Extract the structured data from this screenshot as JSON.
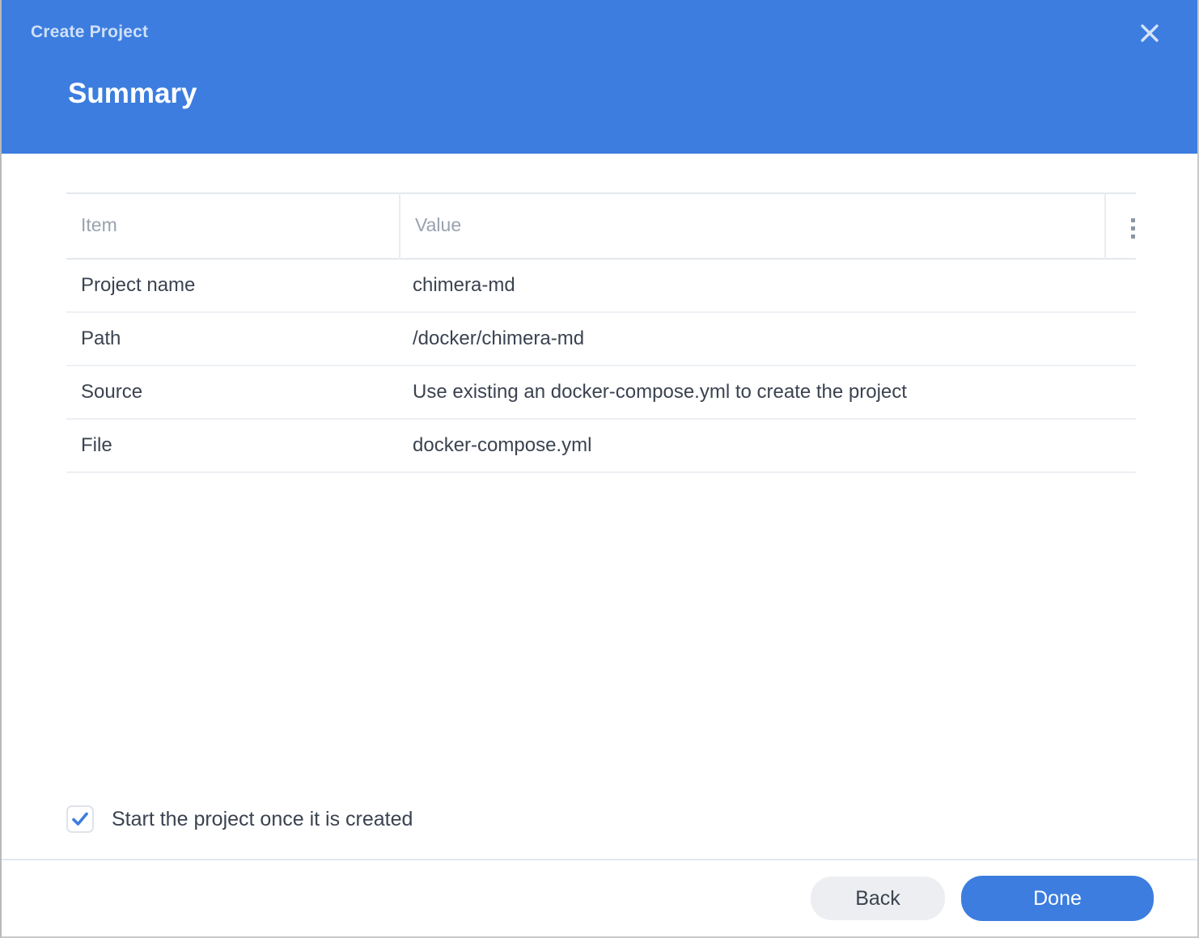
{
  "dialog": {
    "eyebrow": "Create Project",
    "title": "Summary",
    "close_icon": "close-icon"
  },
  "table": {
    "columns": [
      "Item",
      "Value"
    ],
    "menu_icon": "more-options-icon",
    "rows": [
      {
        "item": "Project name",
        "value": "chimera-md"
      },
      {
        "item": "Path",
        "value": "/docker/chimera-md"
      },
      {
        "item": "Source",
        "value": "Use existing an docker-compose.yml to create the project"
      },
      {
        "item": "File",
        "value": "docker-compose.yml"
      }
    ]
  },
  "options": {
    "start_project": {
      "label": "Start the project once it is created",
      "checked": true
    }
  },
  "footer": {
    "back_label": "Back",
    "done_label": "Done"
  },
  "colors": {
    "header_blue": "#3c7ddf",
    "primary_button": "#3c7ddf",
    "secondary_button": "#eceef1",
    "checkbox_check": "#3c7ddf",
    "text_primary": "#3b4350",
    "text_muted": "#9aa2ae",
    "divider": "#e4e8ee"
  }
}
